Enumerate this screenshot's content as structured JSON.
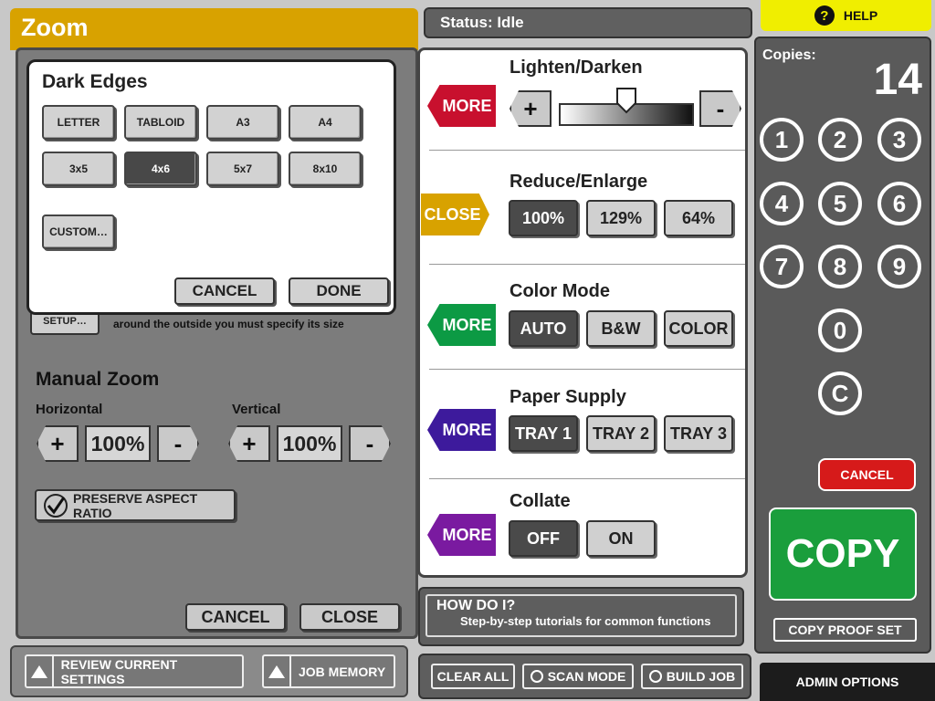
{
  "zoom": {
    "title": "Zoom",
    "dark_edges": {
      "title": "Dark Edges",
      "paper_sizes": [
        "LETTER",
        "TABLOID",
        "A3",
        "A4",
        "3x5",
        "4x6",
        "5x7",
        "8x10"
      ],
      "selected": "4x6",
      "custom_label": "CUSTOM…",
      "cancel_label": "CANCEL",
      "done_label": "DONE"
    },
    "setup_button_label": "SETUP…",
    "setup_hint": "around the outside you must specify its size",
    "manual_zoom": {
      "title": "Manual Zoom",
      "horizontal_label": "Horizontal",
      "horizontal_value": "100%",
      "vertical_label": "Vertical",
      "vertical_value": "100%",
      "plus": "+",
      "minus": "-"
    },
    "preserve_aspect_label": "PRESERVE ASPECT RATIO",
    "preserve_aspect_checked": true,
    "cancel_label": "CANCEL",
    "close_label": "CLOSE"
  },
  "bottom_left": {
    "review_label": "REVIEW CURRENT SETTINGS",
    "job_memory_label": "JOB MEMORY"
  },
  "status": {
    "text": "Status: Idle"
  },
  "lighten_darken": {
    "title": "Lighten/Darken",
    "tag": "MORE",
    "plus": "+",
    "minus": "-",
    "level": 0.5
  },
  "reduce_enlarge": {
    "title": "Reduce/Enlarge",
    "tag": "CLOSE",
    "options": [
      "100%",
      "129%",
      "64%"
    ],
    "selected": "100%"
  },
  "color_mode": {
    "title": "Color Mode",
    "tag": "MORE",
    "options": [
      "AUTO",
      "B&W",
      "COLOR"
    ],
    "selected": "AUTO"
  },
  "paper_supply": {
    "title": "Paper Supply",
    "tag": "MORE",
    "options": [
      "TRAY 1",
      "TRAY 2",
      "TRAY 3"
    ],
    "selected": "TRAY 1"
  },
  "collate": {
    "title": "Collate",
    "tag": "MORE",
    "options": [
      "OFF",
      "ON"
    ],
    "selected": "OFF"
  },
  "help": {
    "label": "HELP",
    "icon": "question-icon",
    "how_do_i_title": "HOW DO I?",
    "how_do_i_subtitle": "Step-by-step tutorials for common functions"
  },
  "copies": {
    "label": "Copies:",
    "count": "14",
    "keys": [
      "1",
      "2",
      "3",
      "4",
      "5",
      "6",
      "7",
      "8",
      "9",
      "0",
      "C"
    ],
    "cancel_label": "CANCEL",
    "copy_label": "COPY",
    "proof_label": "COPY PROOF SET"
  },
  "bottom_center": {
    "clear_all_label": "CLEAR ALL",
    "scan_mode_label": "SCAN MODE",
    "build_job_label": "BUILD JOB"
  },
  "admin_label": "ADMIN OPTIONS",
  "colors": {
    "zoom_accent": "#d8a200",
    "help_yellow": "#f0ee00",
    "more_red": "#c8102e",
    "more_green": "#0c9a44",
    "more_indigo": "#3d1a9c",
    "more_purple": "#7a1aa0",
    "cancel_red": "#d61a1a",
    "copy_green": "#1a9e3c"
  }
}
